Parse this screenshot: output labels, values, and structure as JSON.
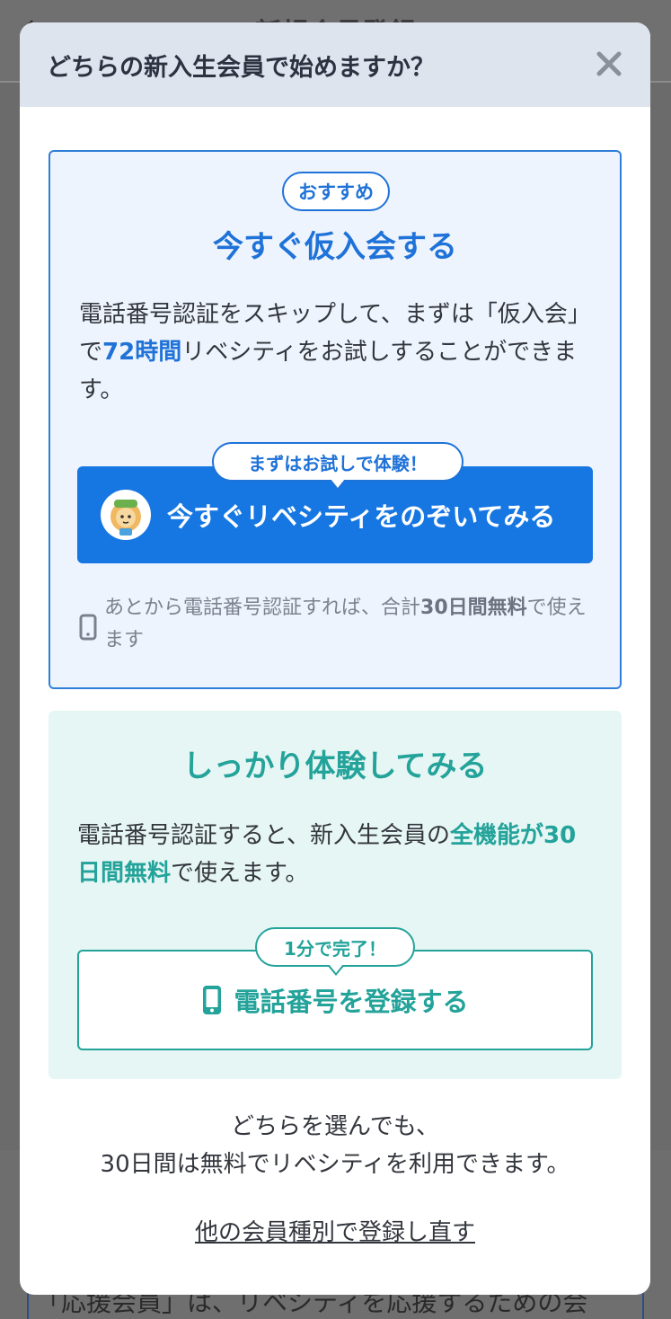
{
  "background": {
    "title": "新規会員登録",
    "bottom_text": "「応援会員」は、リベシティを応援するための会"
  },
  "modal": {
    "title": "どちらの新入生会員で始めますか？",
    "close_icon": "close-icon"
  },
  "option_trial": {
    "badge": "おすすめ",
    "title": "今すぐ仮入会する",
    "desc_1": "電話番号認証をスキップして、まずは「仮入会」で",
    "desc_hl": "72時間",
    "desc_2": "リベシティをお試しすることができます。",
    "bubble": "まずはお試しで体験！",
    "cta_label": "今すぐリベシティをのぞいてみる",
    "note_1": "あとから電話番号認証すれば、合計",
    "note_hl": "30日間無料",
    "note_2": "で使えます"
  },
  "option_full": {
    "title": "しっかり体験してみる",
    "desc_1": "電話番号認証すると、新入生会員の",
    "desc_hl1": "全機能が",
    "desc_hl2": "30日間無料",
    "desc_2": "で使えます。",
    "bubble": "1分で完了！",
    "cta_label": "電話番号を登録する"
  },
  "footer": {
    "line_1": "どちらを選んでも、",
    "line_2": "30日間は無料でリベシティを利用できます。",
    "re_register_link": "他の会員種別で登録し直す"
  },
  "colors": {
    "blue": "#1f72d8",
    "teal": "#23a39a",
    "modal_header_bg": "#dde4ee"
  }
}
